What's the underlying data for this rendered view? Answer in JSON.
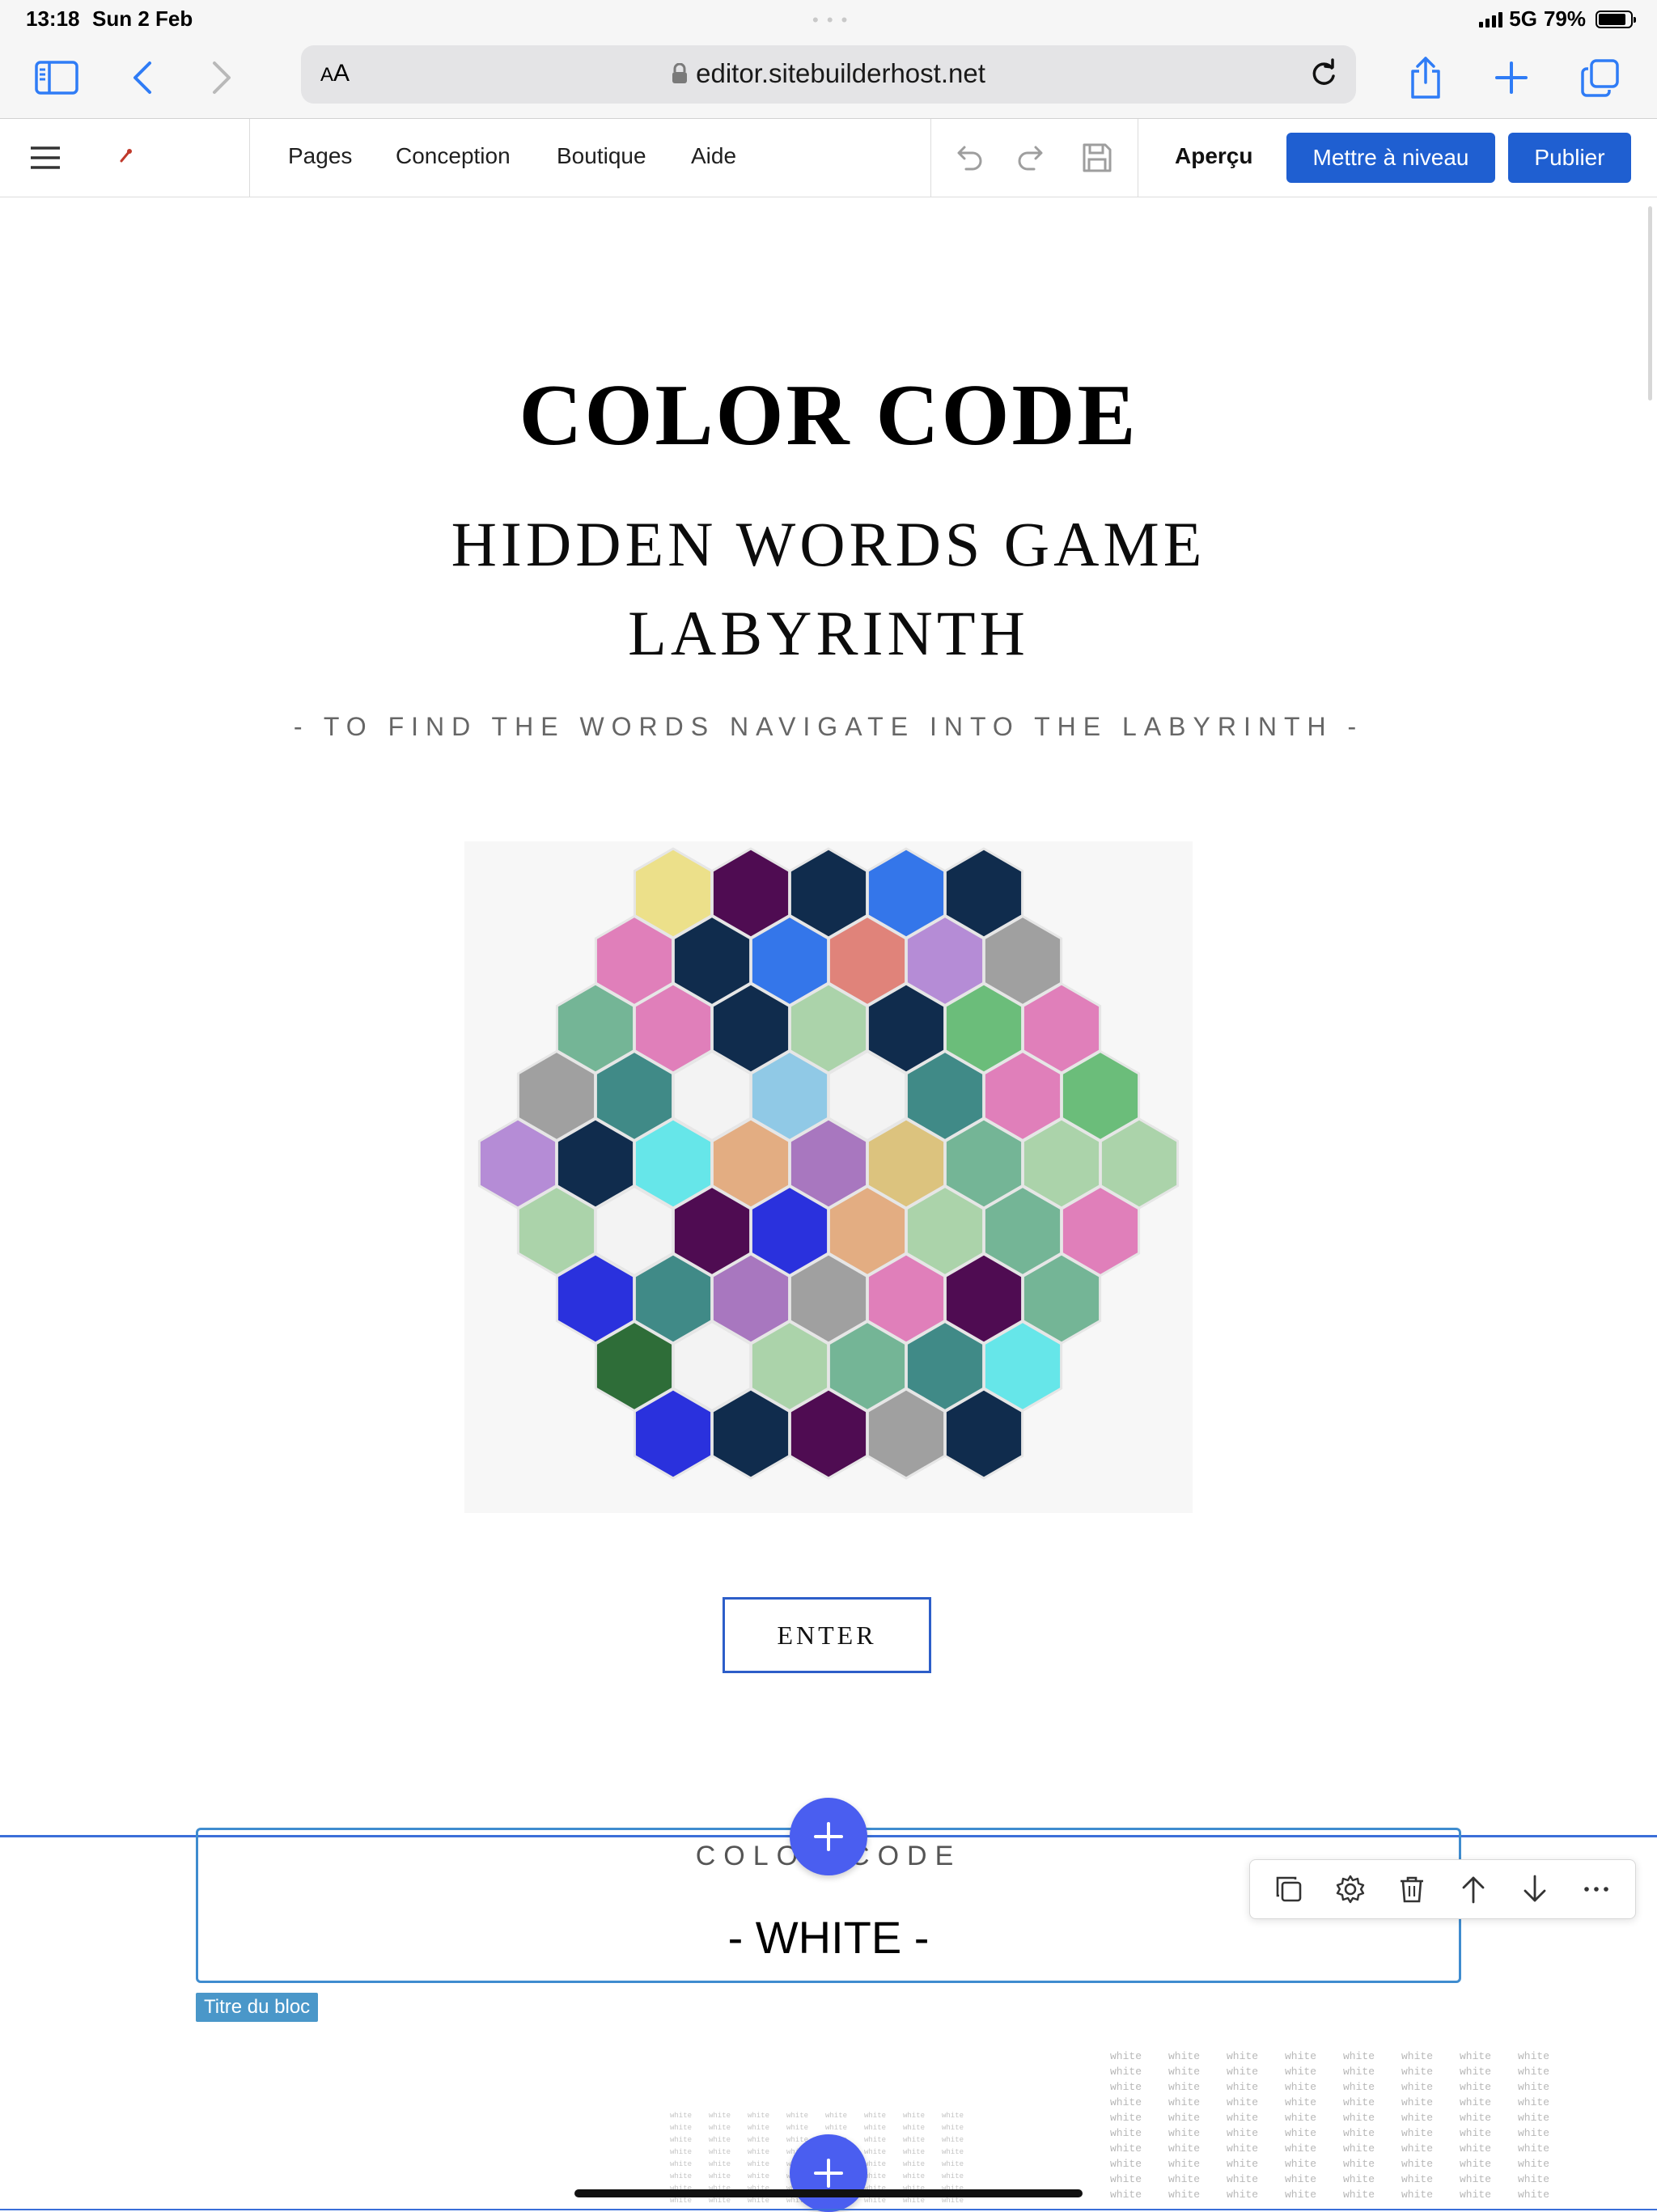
{
  "status_bar": {
    "time": "13:18",
    "date": "Sun 2 Feb",
    "network": "5G",
    "battery": "79%",
    "battery_level": 0.79
  },
  "browser": {
    "reader_label_big": "A",
    "reader_label_small": "A",
    "url": "editor.sitebuilderhost.net"
  },
  "editor": {
    "nav": [
      "Pages",
      "Conception",
      "Boutique",
      "Aide"
    ],
    "preview_label": "Aperçu",
    "upgrade_label": "Mettre à niveau",
    "publish_label": "Publier",
    "accent": "#1f5fd1"
  },
  "page": {
    "title": "COLOR CODE",
    "subtitle_line1": "HIDDEN WORDS GAME",
    "subtitle_line2": "LABYRINTH",
    "tagline": "- TO FIND THE WORDS NAVIGATE INTO THE LABYRINTH -",
    "enter_label": "ENTER",
    "hex_rows": [
      [
        "#ece08a",
        "#4f0c52",
        "#102c4d",
        "#3476ea",
        "#102c4d"
      ],
      [
        "#e07fba",
        "#102c4d",
        "#3476ea",
        "#e0837a",
        "#b58cd6",
        "#a0a0a0"
      ],
      [
        "#74b596",
        "#e07fba",
        "#102c4d",
        "#abd3aa",
        "#102c4d",
        "#6bbd7a",
        "#e07fba"
      ],
      [
        "#a0a0a0",
        "#408a87",
        "#f3f3f3",
        "#90c9e6",
        "#f3f3f3",
        "#408a87",
        "#e07fba",
        "#6bbd7a"
      ],
      [
        "#b58cd6",
        "#102c4d",
        "#66e6e9",
        "#e3ad82",
        "#a877bf",
        "#dcc37e",
        "#74b596",
        "#abd3aa",
        "#abd3aa"
      ],
      [
        "#abd3aa",
        "#f3f3f3",
        "#4f0c52",
        "#2a31dd",
        "#e3ad82",
        "#abd3aa",
        "#74b596",
        "#e07fba"
      ],
      [
        "#2a31dd",
        "#408a87",
        "#a877bf",
        "#a0a0a0",
        "#e07fba",
        "#4f0c52",
        "#74b596"
      ],
      [
        "#2e6d38",
        "#f3f3f3",
        "#abd3aa",
        "#74b596",
        "#408a87",
        "#66e6e9"
      ],
      [
        "#2a31dd",
        "#102c4d",
        "#4f0c52",
        "#a0a0a0",
        "#102c4d"
      ]
    ]
  },
  "selected_block": {
    "label": "COLOR CODE",
    "title": "- WHITE -",
    "tag": "Titre du bloc"
  },
  "tiles": {
    "word": "white"
  }
}
